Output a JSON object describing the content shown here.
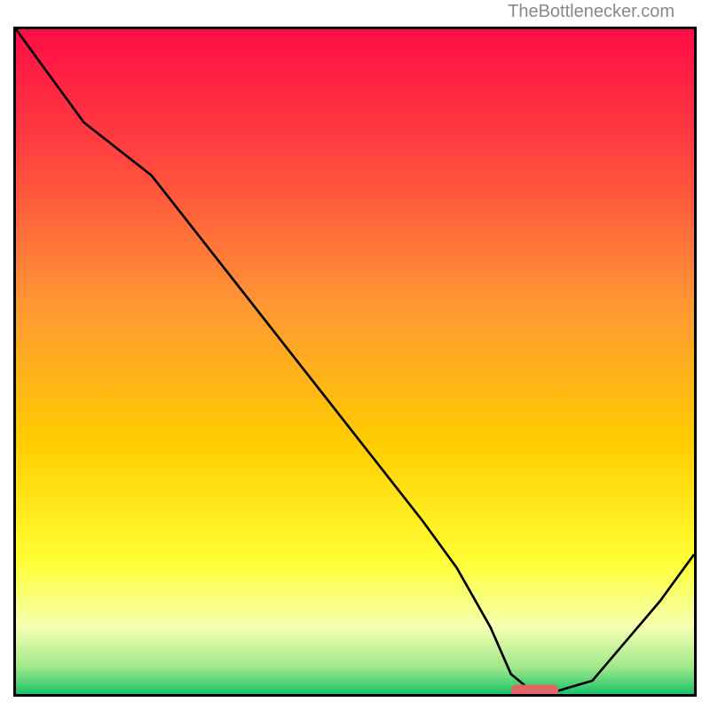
{
  "attribution": "TheBottlenecker.com",
  "chart_data": {
    "type": "line",
    "title": "",
    "xlabel": "",
    "ylabel": "",
    "x": [
      0,
      5,
      10,
      20,
      30,
      40,
      50,
      60,
      65,
      70,
      73,
      76,
      80,
      85,
      90,
      95,
      100
    ],
    "values": [
      100,
      93,
      86,
      78,
      65,
      52,
      39,
      26,
      19,
      10,
      3,
      0.5,
      0.5,
      2,
      8,
      14,
      21
    ],
    "marker": {
      "x_start": 73,
      "x_end": 80,
      "y": 0.5
    },
    "xlim": [
      0,
      100
    ],
    "ylim": [
      0,
      100
    ],
    "gradient": {
      "top": "#ff1a4d",
      "mid_upper": "#ffcc00",
      "mid_lower": "#ffff66",
      "bottom": "#2ecc71"
    }
  }
}
